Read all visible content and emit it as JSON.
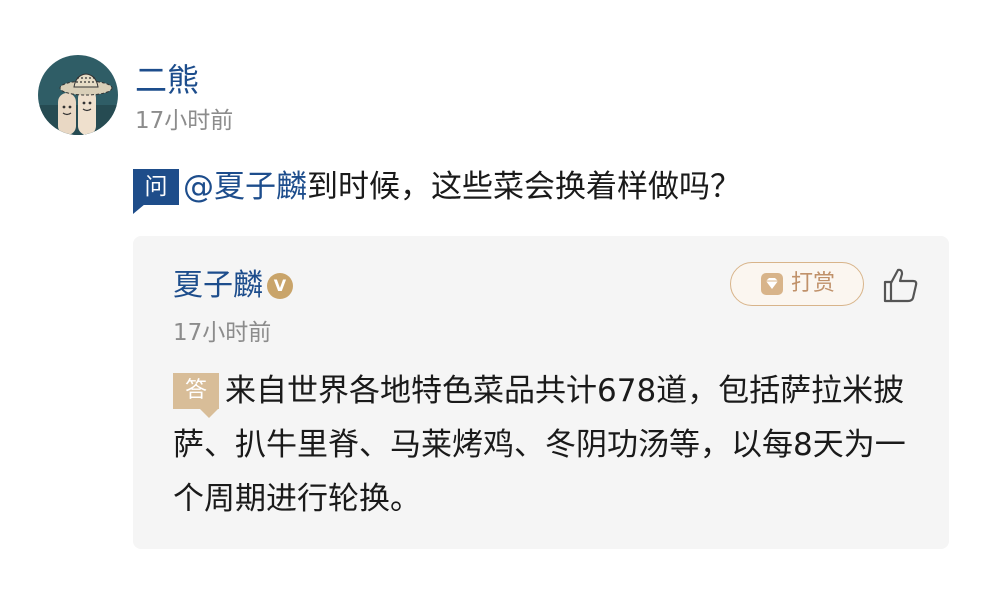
{
  "question": {
    "asker_name": "二熊",
    "asker_time": "17小时前",
    "tag": "问",
    "mention": "@夏子麟",
    "text": "到时候，这些菜会换着样做吗？"
  },
  "answer": {
    "answerer_name": "夏子麟",
    "verified_badge": "V",
    "tip_label": "打赏",
    "time": "17小时前",
    "tag": "答",
    "text": "来自世界各地特色菜品共计678道，包括萨拉米披萨、扒牛里脊、马莱烤鸡、冬阴功汤等，以每8天为一个周期进行轮换。"
  },
  "colors": {
    "link_blue": "#1d4d8c",
    "ask_tag": "#1e4d8a",
    "answer_tag": "#d8bd98",
    "tip_border": "#d8b48a",
    "muted_text": "#8c8c8c",
    "card_bg": "#f5f5f5"
  },
  "icons": {
    "avatar": "avatar-image",
    "verified": "verified-v-icon",
    "tip": "diamond-icon",
    "like": "thumbs-up-icon"
  }
}
